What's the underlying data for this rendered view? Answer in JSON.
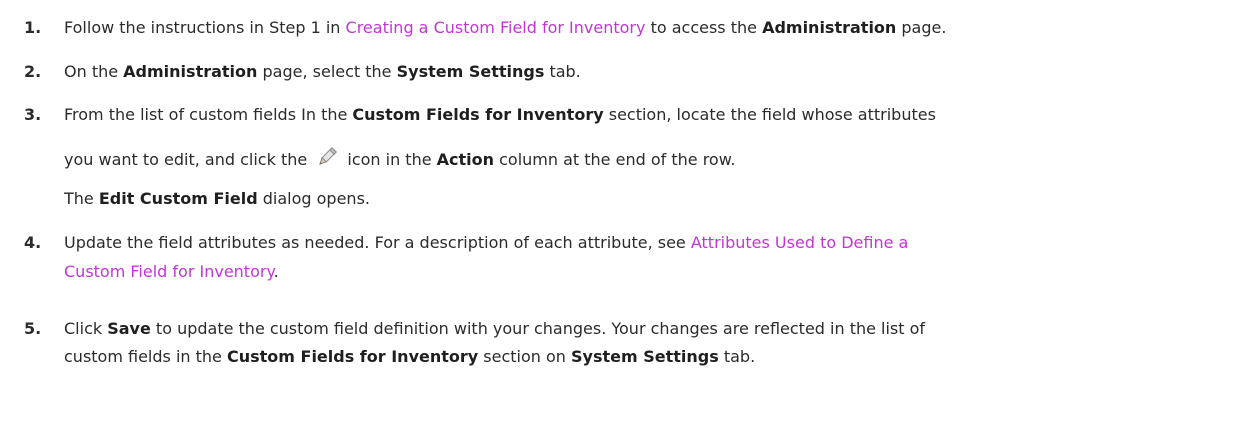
{
  "steps": [
    {
      "num": "1.",
      "p1": "Follow the instructions in Step 1 in ",
      "link": "Creating a Custom Field for Inventory",
      "p2": " to access the ",
      "b1": "Administration",
      "p3": " page."
    },
    {
      "num": "2.",
      "p1": "On the ",
      "b1": "Administration",
      "p2": " page, select the ",
      "b2": "System Settings",
      "p3": " tab."
    },
    {
      "num": "3.",
      "p1": "From the list of custom fields In the ",
      "b1": "Custom Fields for Inventory",
      "p2": " section, locate the field whose attributes",
      "l2p1": "you want to edit, and click the ",
      "icon": "pencil-icon",
      "l2p2": " icon in the ",
      "b2": "Action",
      "l2p3": " column at the end of the row.",
      "sub_p1": "The ",
      "sub_b": "Edit Custom Field",
      "sub_p2": " dialog opens."
    },
    {
      "num": "4.",
      "p1": "Update the field attributes as needed. For a description of each attribute, see ",
      "link1": "Attributes Used to Define a",
      "link2": "Custom Field for Inventory",
      "p2": "."
    },
    {
      "num": "5.",
      "p1": "Click ",
      "b1": "Save",
      "p2": " to update the custom field definition with your changes. Your changes are reflected in the list of",
      "l2p1": "custom fields in the ",
      "b2": "Custom Fields for Inventory",
      "l2p2": " section on ",
      "b3": "System Settings",
      "l2p3": " tab."
    }
  ],
  "colors": {
    "link": "#c236d6",
    "text": "#2b2b2b"
  }
}
